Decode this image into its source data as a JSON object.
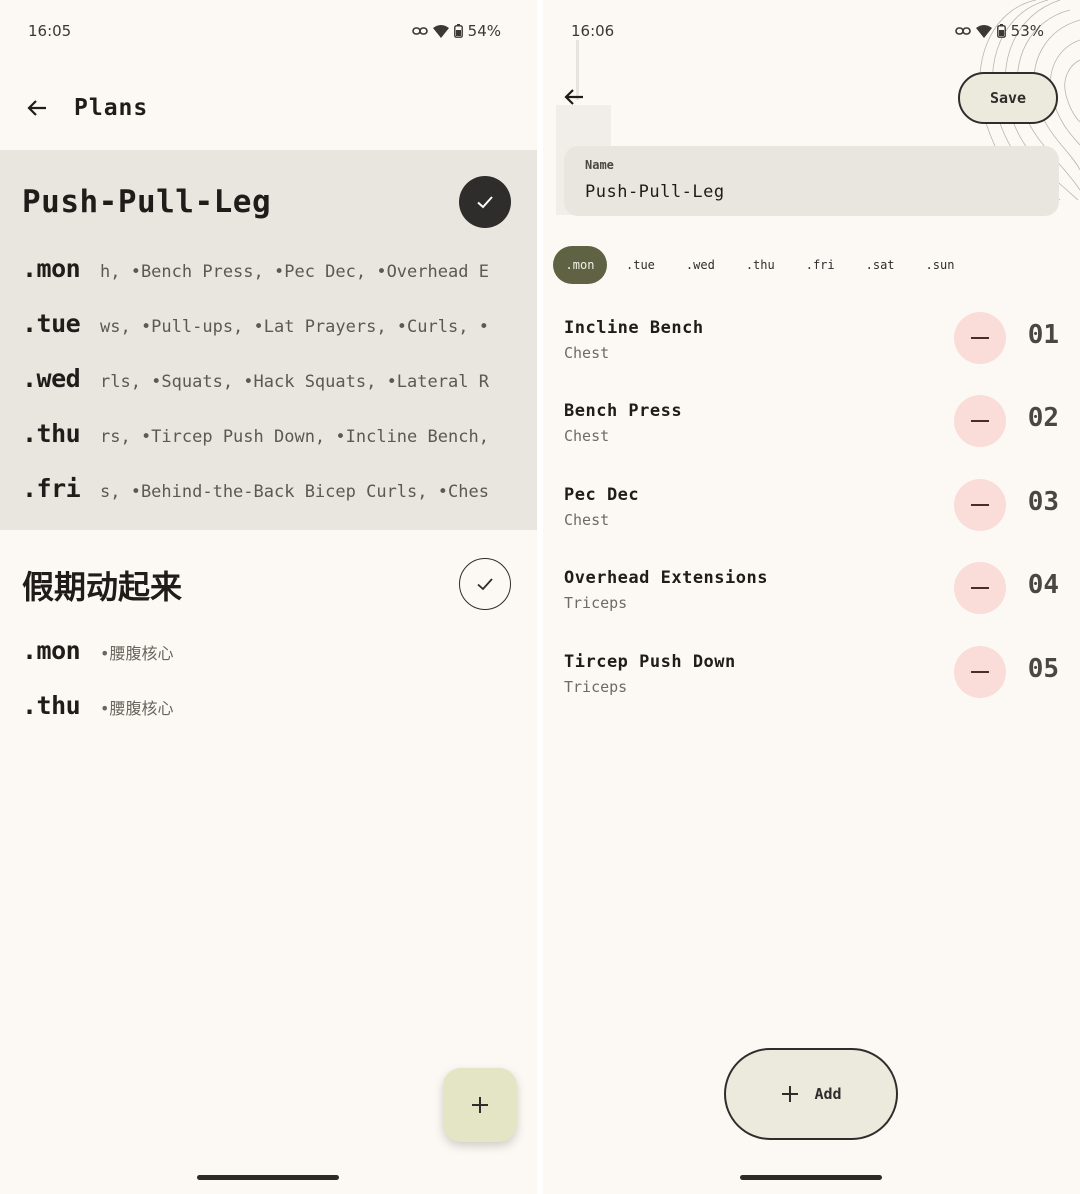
{
  "left": {
    "status": {
      "time": "16:05",
      "battery": "54%"
    },
    "header": {
      "title": "Plans"
    },
    "plans": [
      {
        "title": "Push-Pull-Leg",
        "selected": true,
        "days": [
          {
            "label": ".mon",
            "exercises": "h, •Bench Press, •Pec Dec, •Overhead E"
          },
          {
            "label": ".tue",
            "exercises": "ws, •Pull-ups, •Lat Prayers, •Curls, •"
          },
          {
            "label": ".wed",
            "exercises": "rls, •Squats, •Hack Squats, •Lateral R"
          },
          {
            "label": ".thu",
            "exercises": "rs, •Tircep Push Down, •Incline Bench,"
          },
          {
            "label": ".fri",
            "exercises": "s, •Behind-the-Back Bicep Curls, •Ches"
          }
        ]
      },
      {
        "title": "假期动起来",
        "selected": false,
        "days": [
          {
            "label": ".mon",
            "exercises": "•腰腹核心"
          },
          {
            "label": ".thu",
            "exercises": "•腰腹核心"
          }
        ]
      }
    ],
    "fab_icon": "plus-icon"
  },
  "right": {
    "status": {
      "time": "16:06",
      "battery": "53%"
    },
    "save_label": "Save",
    "name_field": {
      "label": "Name",
      "value": "Push-Pull-Leg"
    },
    "day_tabs": [
      ".mon",
      ".tue",
      ".wed",
      ".thu",
      ".fri",
      ".sat",
      ".sun"
    ],
    "active_day": ".mon",
    "exercises": [
      {
        "name": "Incline Bench",
        "category": "Chest",
        "order": "01"
      },
      {
        "name": "Bench Press",
        "category": "Chest",
        "order": "02"
      },
      {
        "name": "Pec Dec",
        "category": "Chest",
        "order": "03"
      },
      {
        "name": "Overhead Extensions",
        "category": "Triceps",
        "order": "04"
      },
      {
        "name": "Tircep Push Down",
        "category": "Triceps",
        "order": "05"
      }
    ],
    "add_label": "Add"
  },
  "colors": {
    "background": "#fcf9f4",
    "selected_card": "#e9e5df",
    "active_chip": "#5f6344",
    "remove_button": "#fadcd8",
    "fab": "#e4e5c4"
  }
}
